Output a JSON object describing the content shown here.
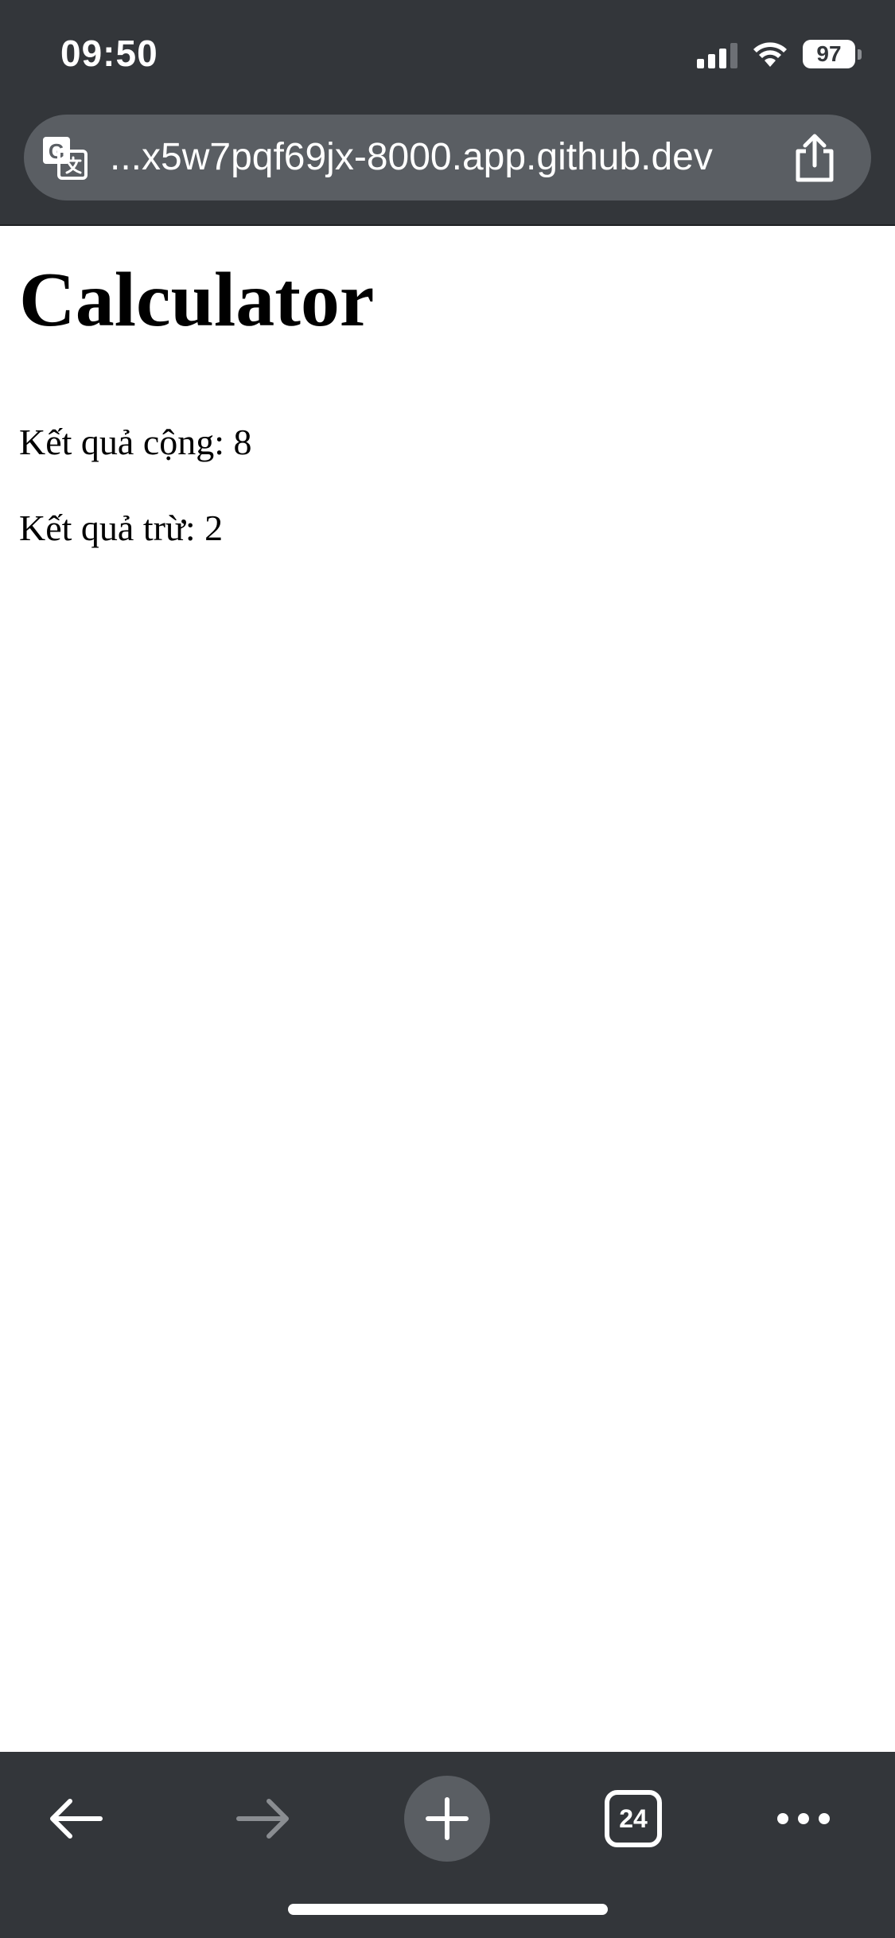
{
  "status_bar": {
    "time": "09:50",
    "battery": "97",
    "icons": [
      "signal-icon",
      "wifi-icon",
      "battery-icon"
    ]
  },
  "address_bar": {
    "url": "...x5w7pqf69jx-8000.app.github.dev",
    "left_icon": "translate-icon",
    "right_icon": "share-icon"
  },
  "page": {
    "title": "Calculator",
    "results": [
      {
        "text": "Kết quả cộng: 8"
      },
      {
        "text": "Kết quả trừ: 2"
      }
    ]
  },
  "toolbar": {
    "back_icon": "back-arrow-icon",
    "forward_icon": "forward-arrow-icon",
    "new_tab_icon": "plus-icon",
    "tab_count": "24",
    "more_icon": "more-icon"
  },
  "colors": {
    "chrome_background": "#33363a",
    "address_bar_background": "#5a5e63",
    "page_background": "#ffffff",
    "text": "#000000"
  }
}
